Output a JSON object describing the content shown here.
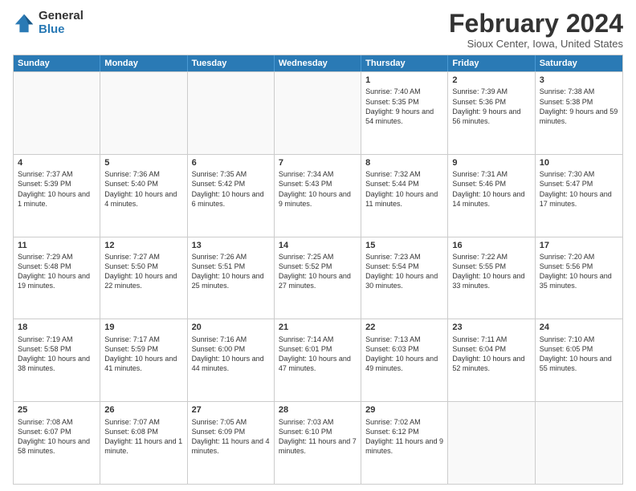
{
  "logo": {
    "general": "General",
    "blue": "Blue"
  },
  "title": "February 2024",
  "location": "Sioux Center, Iowa, United States",
  "headers": [
    "Sunday",
    "Monday",
    "Tuesday",
    "Wednesday",
    "Thursday",
    "Friday",
    "Saturday"
  ],
  "rows": [
    [
      {
        "day": "",
        "info": ""
      },
      {
        "day": "",
        "info": ""
      },
      {
        "day": "",
        "info": ""
      },
      {
        "day": "",
        "info": ""
      },
      {
        "day": "1",
        "info": "Sunrise: 7:40 AM\nSunset: 5:35 PM\nDaylight: 9 hours and 54 minutes."
      },
      {
        "day": "2",
        "info": "Sunrise: 7:39 AM\nSunset: 5:36 PM\nDaylight: 9 hours and 56 minutes."
      },
      {
        "day": "3",
        "info": "Sunrise: 7:38 AM\nSunset: 5:38 PM\nDaylight: 9 hours and 59 minutes."
      }
    ],
    [
      {
        "day": "4",
        "info": "Sunrise: 7:37 AM\nSunset: 5:39 PM\nDaylight: 10 hours and 1 minute."
      },
      {
        "day": "5",
        "info": "Sunrise: 7:36 AM\nSunset: 5:40 PM\nDaylight: 10 hours and 4 minutes."
      },
      {
        "day": "6",
        "info": "Sunrise: 7:35 AM\nSunset: 5:42 PM\nDaylight: 10 hours and 6 minutes."
      },
      {
        "day": "7",
        "info": "Sunrise: 7:34 AM\nSunset: 5:43 PM\nDaylight: 10 hours and 9 minutes."
      },
      {
        "day": "8",
        "info": "Sunrise: 7:32 AM\nSunset: 5:44 PM\nDaylight: 10 hours and 11 minutes."
      },
      {
        "day": "9",
        "info": "Sunrise: 7:31 AM\nSunset: 5:46 PM\nDaylight: 10 hours and 14 minutes."
      },
      {
        "day": "10",
        "info": "Sunrise: 7:30 AM\nSunset: 5:47 PM\nDaylight: 10 hours and 17 minutes."
      }
    ],
    [
      {
        "day": "11",
        "info": "Sunrise: 7:29 AM\nSunset: 5:48 PM\nDaylight: 10 hours and 19 minutes."
      },
      {
        "day": "12",
        "info": "Sunrise: 7:27 AM\nSunset: 5:50 PM\nDaylight: 10 hours and 22 minutes."
      },
      {
        "day": "13",
        "info": "Sunrise: 7:26 AM\nSunset: 5:51 PM\nDaylight: 10 hours and 25 minutes."
      },
      {
        "day": "14",
        "info": "Sunrise: 7:25 AM\nSunset: 5:52 PM\nDaylight: 10 hours and 27 minutes."
      },
      {
        "day": "15",
        "info": "Sunrise: 7:23 AM\nSunset: 5:54 PM\nDaylight: 10 hours and 30 minutes."
      },
      {
        "day": "16",
        "info": "Sunrise: 7:22 AM\nSunset: 5:55 PM\nDaylight: 10 hours and 33 minutes."
      },
      {
        "day": "17",
        "info": "Sunrise: 7:20 AM\nSunset: 5:56 PM\nDaylight: 10 hours and 35 minutes."
      }
    ],
    [
      {
        "day": "18",
        "info": "Sunrise: 7:19 AM\nSunset: 5:58 PM\nDaylight: 10 hours and 38 minutes."
      },
      {
        "day": "19",
        "info": "Sunrise: 7:17 AM\nSunset: 5:59 PM\nDaylight: 10 hours and 41 minutes."
      },
      {
        "day": "20",
        "info": "Sunrise: 7:16 AM\nSunset: 6:00 PM\nDaylight: 10 hours and 44 minutes."
      },
      {
        "day": "21",
        "info": "Sunrise: 7:14 AM\nSunset: 6:01 PM\nDaylight: 10 hours and 47 minutes."
      },
      {
        "day": "22",
        "info": "Sunrise: 7:13 AM\nSunset: 6:03 PM\nDaylight: 10 hours and 49 minutes."
      },
      {
        "day": "23",
        "info": "Sunrise: 7:11 AM\nSunset: 6:04 PM\nDaylight: 10 hours and 52 minutes."
      },
      {
        "day": "24",
        "info": "Sunrise: 7:10 AM\nSunset: 6:05 PM\nDaylight: 10 hours and 55 minutes."
      }
    ],
    [
      {
        "day": "25",
        "info": "Sunrise: 7:08 AM\nSunset: 6:07 PM\nDaylight: 10 hours and 58 minutes."
      },
      {
        "day": "26",
        "info": "Sunrise: 7:07 AM\nSunset: 6:08 PM\nDaylight: 11 hours and 1 minute."
      },
      {
        "day": "27",
        "info": "Sunrise: 7:05 AM\nSunset: 6:09 PM\nDaylight: 11 hours and 4 minutes."
      },
      {
        "day": "28",
        "info": "Sunrise: 7:03 AM\nSunset: 6:10 PM\nDaylight: 11 hours and 7 minutes."
      },
      {
        "day": "29",
        "info": "Sunrise: 7:02 AM\nSunset: 6:12 PM\nDaylight: 11 hours and 9 minutes."
      },
      {
        "day": "",
        "info": ""
      },
      {
        "day": "",
        "info": ""
      }
    ]
  ]
}
